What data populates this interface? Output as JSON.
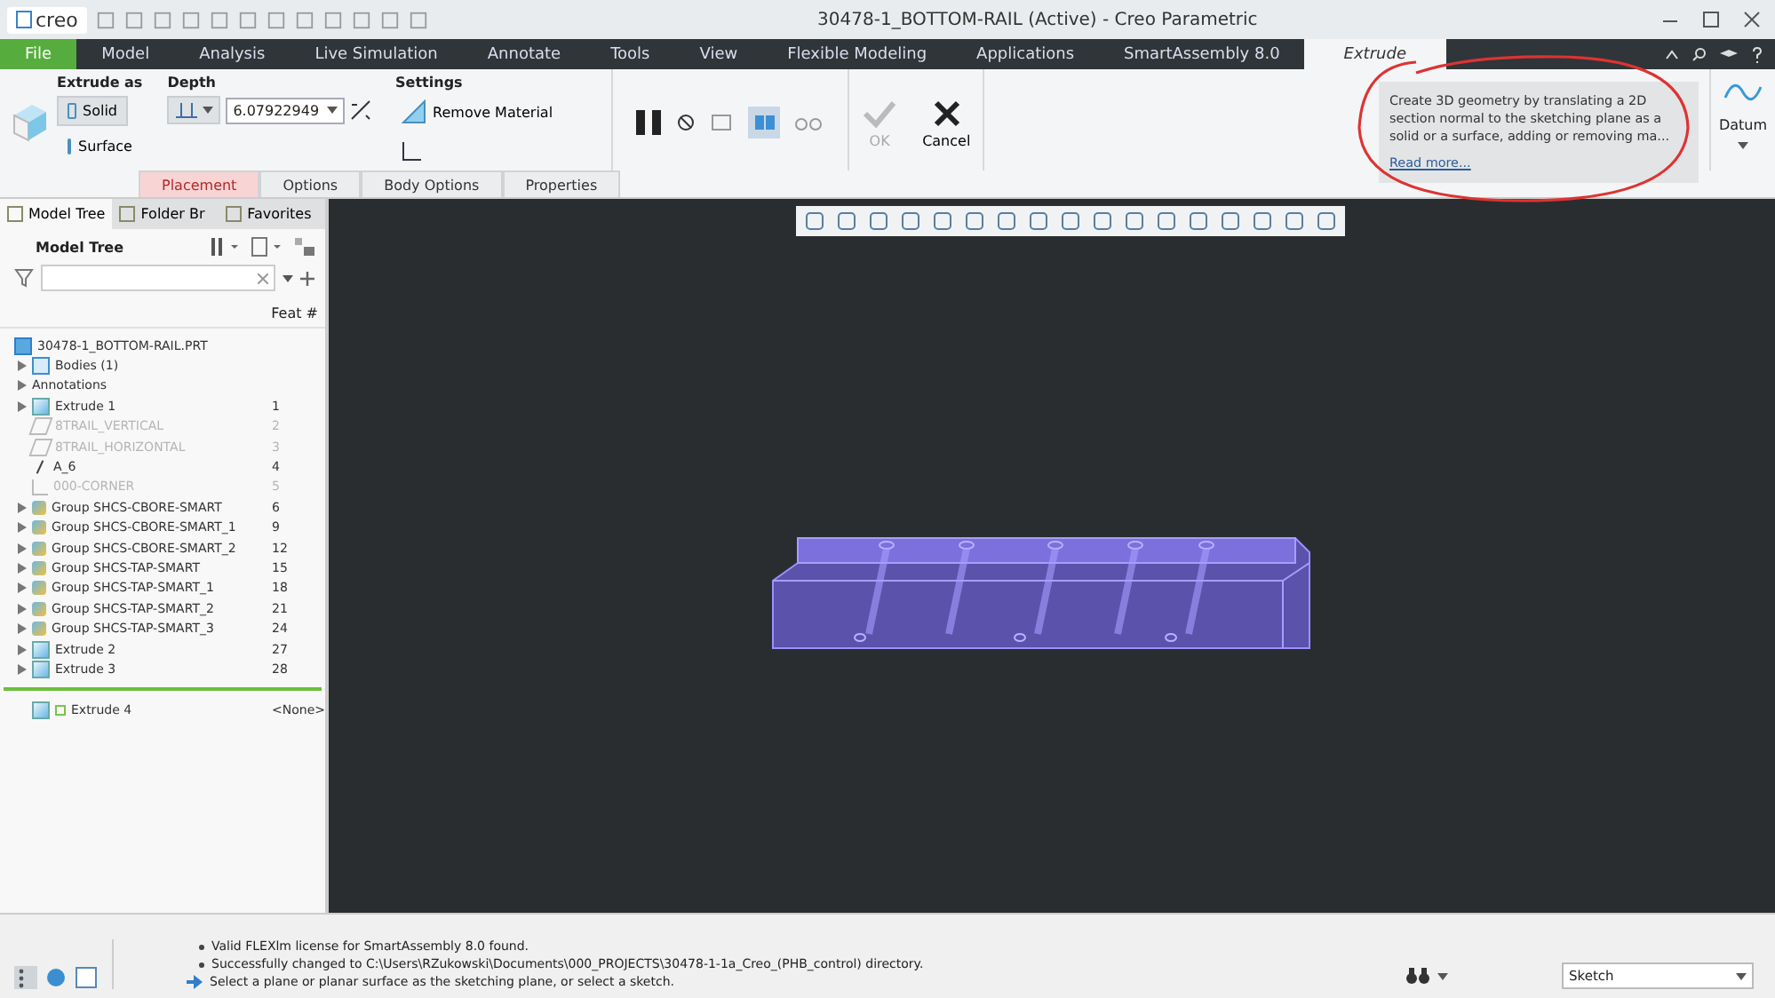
{
  "window": {
    "app_logo": "creo",
    "title": "30478-1_BOTTOM-RAIL (Active) - Creo Parametric"
  },
  "menu_tabs": [
    {
      "label": "File",
      "kind": "file",
      "selected": false
    },
    {
      "label": "Model",
      "kind": "tab",
      "selected": false
    },
    {
      "label": "Analysis",
      "kind": "tab",
      "selected": false
    },
    {
      "label": "Live Simulation",
      "kind": "tab",
      "selected": false
    },
    {
      "label": "Annotate",
      "kind": "tab",
      "selected": false
    },
    {
      "label": "Tools",
      "kind": "tab",
      "selected": false
    },
    {
      "label": "View",
      "kind": "tab",
      "selected": false
    },
    {
      "label": "Flexible Modeling",
      "kind": "tab",
      "selected": false
    },
    {
      "label": "Applications",
      "kind": "tab",
      "selected": false
    },
    {
      "label": "SmartAssembly 8.0",
      "kind": "tab",
      "selected": false
    },
    {
      "label": "Extrude",
      "kind": "tab",
      "selected": true
    }
  ],
  "ribbon": {
    "extrude_as": {
      "heading": "Extrude as",
      "options": [
        {
          "label": "Solid",
          "selected": true
        },
        {
          "label": "Surface",
          "selected": false
        }
      ]
    },
    "depth": {
      "heading": "Depth",
      "value": "6.07922949"
    },
    "settings": {
      "heading": "Settings",
      "remove_material": {
        "label": "Remove Material",
        "on": false
      }
    },
    "ok": {
      "label": "OK",
      "disabled": true
    },
    "cancel": {
      "label": "Cancel",
      "disabled": false
    },
    "help": {
      "text": "Create 3D geometry by translating a 2D section normal to the sketching plane as a solid or a surface, adding or removing ma...",
      "link": "Read more..."
    },
    "datum": {
      "label": "Datum"
    },
    "sub_tabs": [
      {
        "label": "Placement",
        "selected": true
      },
      {
        "label": "Options",
        "selected": false
      },
      {
        "label": "Body Options",
        "selected": false
      },
      {
        "label": "Properties",
        "selected": false
      }
    ]
  },
  "left_tabs": [
    {
      "label": "Model Tree",
      "selected": true
    },
    {
      "label": "Folder Br",
      "selected": false
    },
    {
      "label": "Favorites",
      "selected": false
    }
  ],
  "model_tree": {
    "title": "Model Tree",
    "column": "Feat #",
    "root": {
      "label": "30478-1_BOTTOM-RAIL.PRT",
      "children": [
        {
          "label": "Bodies (1)",
          "kind": "bodies",
          "suppressed": false,
          "expandable": true
        },
        {
          "label": "Annotations",
          "kind": "plain",
          "suppressed": false,
          "expandable": true
        },
        {
          "label": "Extrude 1",
          "feat": "1",
          "kind": "extrude",
          "suppressed": false,
          "expandable": true
        },
        {
          "label": "8TRAIL_VERTICAL",
          "feat": "2",
          "kind": "plane",
          "suppressed": true,
          "expandable": false
        },
        {
          "label": "8TRAIL_HORIZONTAL",
          "feat": "3",
          "kind": "plane",
          "suppressed": true,
          "expandable": false
        },
        {
          "label": "A_6",
          "feat": "4",
          "kind": "axis",
          "suppressed": false,
          "expandable": false
        },
        {
          "label": "000-CORNER",
          "feat": "5",
          "kind": "csys",
          "suppressed": true,
          "expandable": false
        },
        {
          "label": "Group SHCS-CBORE-SMART",
          "feat": "6",
          "kind": "group",
          "suppressed": false,
          "expandable": true
        },
        {
          "label": "Group SHCS-CBORE-SMART_1",
          "feat": "9",
          "kind": "group",
          "suppressed": false,
          "expandable": true
        },
        {
          "label": "Group SHCS-CBORE-SMART_2",
          "feat": "12",
          "kind": "group",
          "suppressed": false,
          "expandable": true
        },
        {
          "label": "Group SHCS-TAP-SMART",
          "feat": "15",
          "kind": "group",
          "suppressed": false,
          "expandable": true
        },
        {
          "label": "Group SHCS-TAP-SMART_1",
          "feat": "18",
          "kind": "group",
          "suppressed": false,
          "expandable": true
        },
        {
          "label": "Group SHCS-TAP-SMART_2",
          "feat": "21",
          "kind": "group",
          "suppressed": false,
          "expandable": true
        },
        {
          "label": "Group SHCS-TAP-SMART_3",
          "feat": "24",
          "kind": "group",
          "suppressed": false,
          "expandable": true
        },
        {
          "label": "Extrude 2",
          "feat": "27",
          "kind": "extrude",
          "suppressed": false,
          "expandable": true
        },
        {
          "label": "Extrude 3",
          "feat": "28",
          "kind": "extrude",
          "suppressed": false,
          "expandable": true
        }
      ]
    },
    "new_feature": {
      "label": "Extrude 4",
      "feat": "<None>"
    }
  },
  "messages": [
    {
      "text": "Valid FLEXlm license for SmartAssembly 8.0 found.",
      "kind": "info"
    },
    {
      "text": "Successfully changed to C:\\Users\\RZukowski\\Documents\\000_PROJECTS\\30478-1-1a_Creo_(PHB_control) directory.",
      "kind": "info"
    },
    {
      "text": "Select a plane or planar surface as the sketching plane, or select a sketch.",
      "kind": "prompt"
    }
  ],
  "selection_filter": {
    "value": "Sketch"
  }
}
